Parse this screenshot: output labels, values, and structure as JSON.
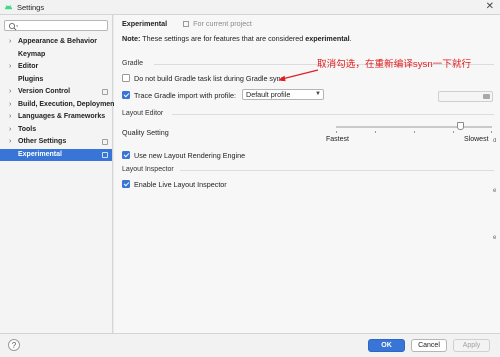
{
  "window": {
    "title": "Settings",
    "close_glyph": "✕",
    "icon": "android-icon"
  },
  "sidebar": {
    "search_placeholder": "",
    "items": [
      {
        "label": "Appearance & Behavior",
        "expandable": true,
        "project": false
      },
      {
        "label": "Keymap",
        "expandable": false,
        "project": false
      },
      {
        "label": "Editor",
        "expandable": true,
        "project": false
      },
      {
        "label": "Plugins",
        "expandable": false,
        "project": false
      },
      {
        "label": "Version Control",
        "expandable": true,
        "project": true
      },
      {
        "label": "Build, Execution, Deployment",
        "expandable": true,
        "project": false
      },
      {
        "label": "Languages & Frameworks",
        "expandable": true,
        "project": false
      },
      {
        "label": "Tools",
        "expandable": true,
        "project": false
      },
      {
        "label": "Other Settings",
        "expandable": true,
        "project": true
      },
      {
        "label": "Experimental",
        "expandable": false,
        "project": true,
        "selected": true
      }
    ]
  },
  "main": {
    "breadcrumb": {
      "current": "Experimental",
      "context": "For current project"
    },
    "note": {
      "prefix": "Note:",
      "text": " These settings are for features that are considered ",
      "emphasis": "experimental",
      "suffix": "."
    },
    "gradle": {
      "section": "Gradle",
      "skip_task_list": {
        "label": "Do not build Gradle task list during Gradle sync",
        "checked": false
      },
      "trace_import": {
        "label": "Trace Gradle import with profile:",
        "checked": true
      },
      "profile_select": {
        "value": "Default profile"
      },
      "path_value": ""
    },
    "layout_editor": {
      "section": "Layout Editor",
      "quality_label": "Quality Setting",
      "quality_level": 0.78,
      "min_label": "Fastest",
      "max_label": "Slowest",
      "new_rendering": {
        "label": "Use new Layout Rendering Engine",
        "checked": true
      }
    },
    "layout_inspector": {
      "section": "Layout Inspector",
      "live_inspector": {
        "label": "Enable Live Layout Inspector",
        "checked": true
      }
    }
  },
  "annotation": {
    "text": "取消勾选，在重新编译sysn一下就行",
    "color": "#e02020"
  },
  "buttons": {
    "help": "?",
    "ok": "OK",
    "cancel": "Cancel",
    "apply": "Apply"
  },
  "colors": {
    "accent": "#3875d7",
    "selected_text": "#ffffff"
  }
}
